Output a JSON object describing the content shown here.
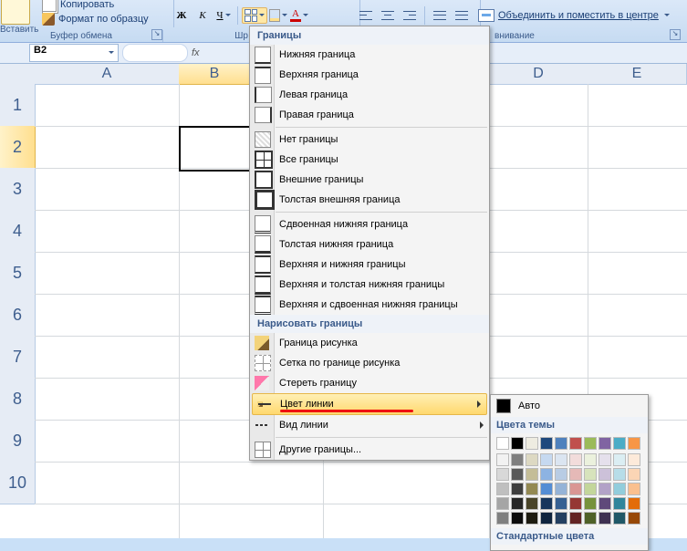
{
  "ribbon": {
    "paste_label": "Вставить",
    "copy_label": "Копировать",
    "format_painter_label": "Формат по образцу",
    "clipboard_group": "Буфер обмена",
    "font_group_partial": "Шр",
    "bold": "Ж",
    "italic": "К",
    "underline": "Ч",
    "merge_center": "Объединить и поместить в центре",
    "alignment_group_partial": "внивание"
  },
  "namebox": "B2",
  "fx": "fx",
  "cols": [
    "A",
    "B",
    "D",
    "E"
  ],
  "rows": [
    "1",
    "2",
    "3",
    "4",
    "5",
    "6",
    "7",
    "8",
    "9",
    "10"
  ],
  "menu": {
    "header_borders": "Границы",
    "items1": [
      "Нижняя граница",
      "Верхняя граница",
      "Левая граница",
      "Правая граница"
    ],
    "items2": [
      "Нет границы",
      "Все границы",
      "Внешние границы",
      "Толстая внешняя граница"
    ],
    "items3": [
      "Сдвоенная нижняя граница",
      "Толстая нижняя граница",
      "Верхняя и нижняя границы",
      "Верхняя и толстая нижняя границы",
      "Верхняя и сдвоенная нижняя границы"
    ],
    "header_draw": "Нарисовать границы",
    "items4": [
      "Граница рисунка",
      "Сетка по границе рисунка",
      "Стереть границу"
    ],
    "line_color": "Цвет линии",
    "line_style": "Вид линии",
    "more_borders": "Другие границы..."
  },
  "color_menu": {
    "auto": "Авто",
    "theme": "Цвета темы",
    "standard": "Стандартные цвета",
    "theme_row1": [
      "#ffffff",
      "#000000",
      "#eeece1",
      "#1f497d",
      "#4f81bd",
      "#c0504d",
      "#9bbb59",
      "#8064a2",
      "#4bacc6",
      "#f79646"
    ],
    "theme_shades": [
      [
        "#f2f2f2",
        "#7f7f7f",
        "#ddd9c3",
        "#c6d9f0",
        "#dbe5f1",
        "#f2dcdb",
        "#ebf1dd",
        "#e5e0ec",
        "#dbeef3",
        "#fdeada"
      ],
      [
        "#d8d8d8",
        "#595959",
        "#c4bd97",
        "#8db3e2",
        "#b8cce4",
        "#e5b9b7",
        "#d7e3bc",
        "#ccc1d9",
        "#b7dde8",
        "#fbd5b5"
      ],
      [
        "#bfbfbf",
        "#3f3f3f",
        "#938953",
        "#548dd4",
        "#95b3d7",
        "#d99694",
        "#c3d69b",
        "#b2a2c7",
        "#92cddc",
        "#fac08f"
      ],
      [
        "#a5a5a5",
        "#262626",
        "#494429",
        "#17365d",
        "#366092",
        "#953734",
        "#76923c",
        "#5f497a",
        "#31859b",
        "#e36c09"
      ],
      [
        "#7f7f7f",
        "#0c0c0c",
        "#1d1b10",
        "#0f243e",
        "#244061",
        "#632423",
        "#4f6128",
        "#3f3151",
        "#205867",
        "#974806"
      ]
    ]
  }
}
